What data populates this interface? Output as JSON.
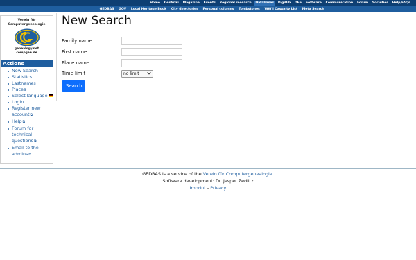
{
  "nav": {
    "top": [
      "Home",
      "GenWiki",
      "Magazine",
      "Events",
      "Regional research",
      "Databases",
      "DigiBib",
      "DES",
      "Software",
      "Communication",
      "Forum",
      "Societies",
      "Help/FAQs"
    ],
    "active_top": "Databases",
    "sub": [
      "GEDBAS",
      "GOV",
      "Local Heritage Book",
      "City directories",
      "Personal columns",
      "Tombstones",
      "WW I Casualty List",
      "Meta Search"
    ]
  },
  "sidebar": {
    "logo_title_line1": "Verein für",
    "logo_title_line2": "Computergenealogie",
    "logo_sub_line1": "genealogy.net",
    "logo_sub_line2": "compgen.de",
    "actions_heading": "Actions",
    "actions": [
      "New Search",
      "Statistics",
      "Lastnames",
      "Places",
      "Select language",
      "Login",
      "Register new account",
      "Help",
      "Forum for technical questions",
      "Email to the admins"
    ]
  },
  "main": {
    "title": "New Search",
    "family_name_label": "Family name",
    "first_name_label": "First name",
    "place_name_label": "Place name",
    "time_limit_label": "Time limit",
    "family_name_value": "",
    "first_name_value": "",
    "place_name_value": "",
    "time_limit_value": "no limit",
    "search_button": "Search"
  },
  "footer": {
    "line1_prefix": "GEDBAS is a service of the",
    "line1_link": "Verein für Computergenealogie",
    "line1_suffix": ".",
    "line2": "Software development: Dr. Jesper Zedlitz",
    "imprint": "Imprint",
    "separator": "-",
    "privacy": "Privacy"
  },
  "colors": {
    "nav_dark": "#0e3f73",
    "nav_light": "#1f5e9f",
    "button": "#0d6efd"
  }
}
